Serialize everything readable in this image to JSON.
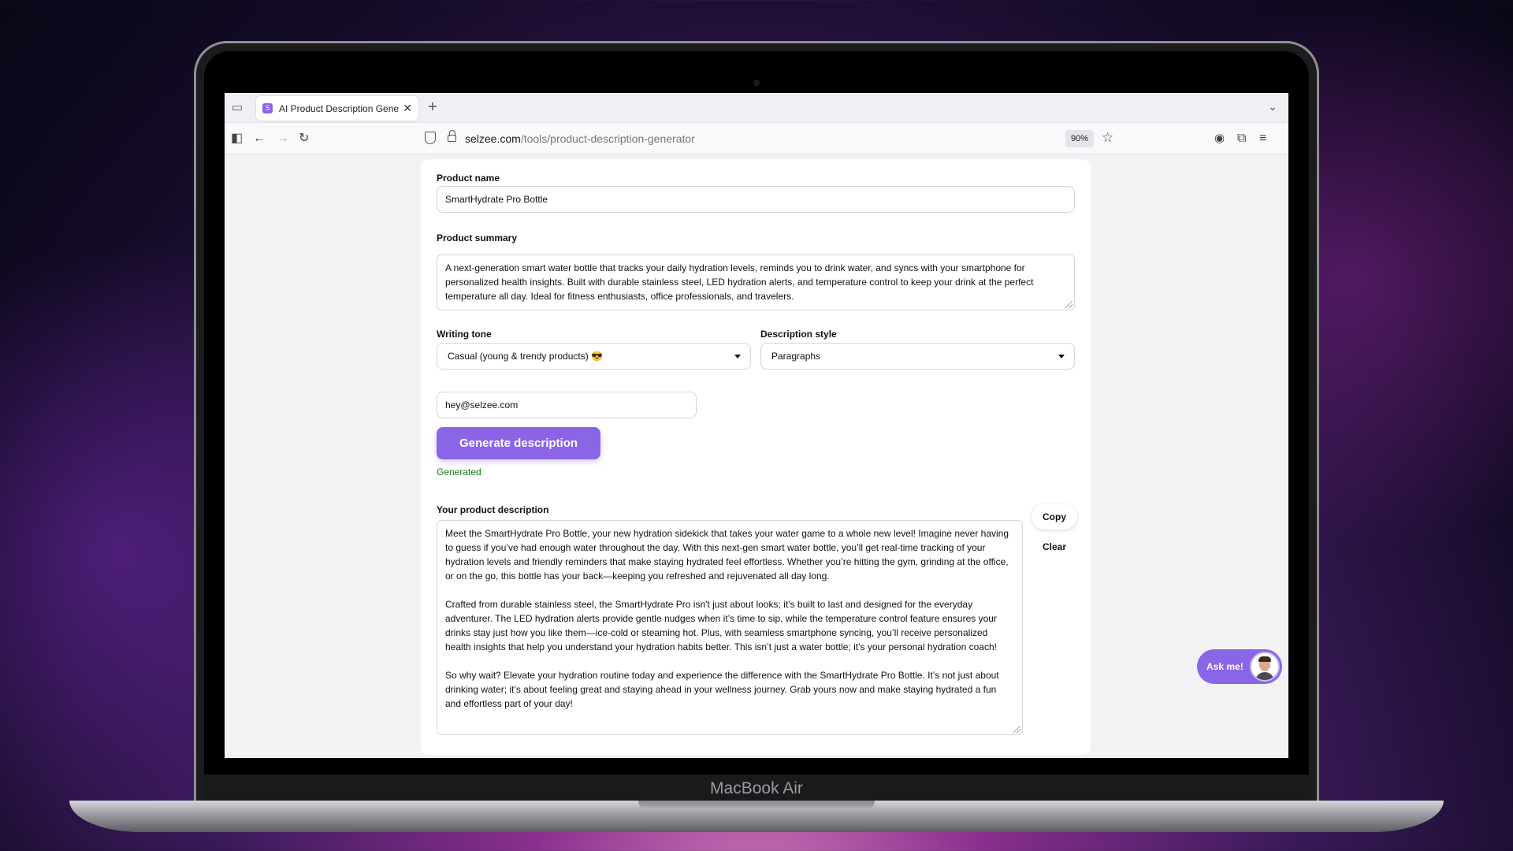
{
  "device": {
    "brand": "MacBook Air"
  },
  "browser": {
    "tab": {
      "title": "AI Product Description Generator",
      "favicon_letter": "S"
    },
    "url": {
      "host": "selzee.com",
      "path": "/tools/product-description-generator"
    },
    "zoom": "90%"
  },
  "form": {
    "product_name_label": "Product name",
    "product_name_value": "SmartHydrate Pro Bottle",
    "product_summary_label": "Product summary",
    "product_summary_value": "A next-generation smart water bottle that tracks your daily hydration levels, reminds you to drink water, and syncs with your smartphone for personalized health insights. Built with durable stainless steel, LED hydration alerts, and temperature control to keep your drink at the perfect temperature all day. Ideal for fitness enthusiasts, office professionals, and travelers.",
    "writing_tone_label": "Writing tone",
    "writing_tone_value": "Casual (young & trendy products) 😎",
    "description_style_label": "Description style",
    "description_style_value": "Paragraphs",
    "email_value": "hey@selzee.com",
    "generate_button": "Generate description",
    "status": "Generated"
  },
  "output": {
    "label": "Your product description",
    "paragraphs": [
      "Meet the SmartHydrate Pro Bottle, your new hydration sidekick that takes your water game to a whole new level! Imagine never having to guess if you’ve had enough water throughout the day. With this next-gen smart water bottle, you’ll get real-time tracking of your hydration levels and friendly reminders that make staying hydrated feel effortless. Whether you’re hitting the gym, grinding at the office, or on the go, this bottle has your back—keeping you refreshed and rejuvenated all day long.",
      "Crafted from durable stainless steel, the SmartHydrate Pro isn't just about looks; it’s built to last and designed for the everyday adventurer. The LED hydration alerts provide gentle nudges when it’s time to sip, while the temperature control feature ensures your drinks stay just how you like them—ice-cold or steaming hot. Plus, with seamless smartphone syncing, you’ll receive personalized health insights that help you understand your hydration habits better. This isn’t just a water bottle; it’s your personal hydration coach!",
      "So why wait? Elevate your hydration routine today and experience the difference with the SmartHydrate Pro Bottle. It’s not just about drinking water; it’s about feeling great and staying ahead in your wellness journey. Grab yours now and make staying hydrated a fun and effortless part of your day!"
    ],
    "copy_button": "Copy",
    "clear_button": "Clear"
  },
  "chat_widget": {
    "label": "Ask me!"
  },
  "colors": {
    "accent": "#8a66e6",
    "status_green": "#137a13"
  }
}
